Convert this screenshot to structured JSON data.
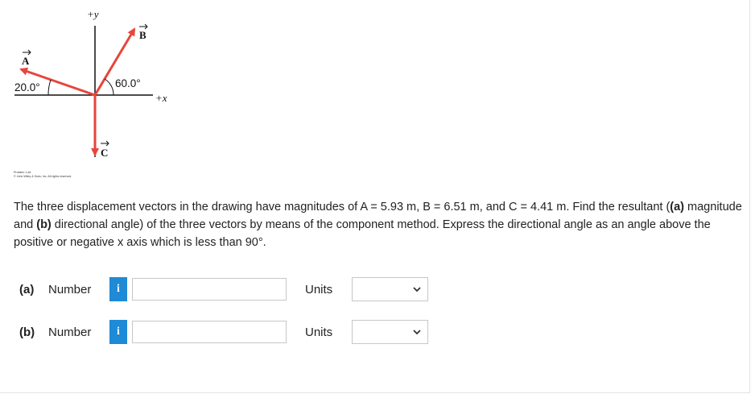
{
  "diagram": {
    "axis_y_label": "+y",
    "axis_x_label": "+x",
    "vector_a_label": "A",
    "vector_b_label": "B",
    "vector_c_label": "C",
    "angle_a_label": "20.0°",
    "angle_b_label": "60.0°",
    "credit_line_1": "Problem 1.##",
    "credit_line_2": "© John Wiley & Sons, Inc. All rights reserved.",
    "vector_color": "#e8453c"
  },
  "question": {
    "seg1": "The three displacement vectors in the drawing have magnitudes of A = 5.93 m, B = 6.51 m, and C = 4.41 m. Find the resultant (",
    "bold_a": "(a)",
    "seg2": " magnitude and ",
    "bold_b": "(b)",
    "seg3": " directional angle) of the three vectors by means of the component method. Express the directional angle as an angle above the positive or negative x axis which is less than 90°."
  },
  "answers": [
    {
      "part": "(a)",
      "label": "Number",
      "info_icon": "i",
      "value": "",
      "units_label": "Units",
      "units_value": ""
    },
    {
      "part": "(b)",
      "label": "Number",
      "info_icon": "i",
      "value": "",
      "units_label": "Units",
      "units_value": ""
    }
  ],
  "colors": {
    "accent": "#1f8ad6",
    "vector": "#e8453c"
  }
}
